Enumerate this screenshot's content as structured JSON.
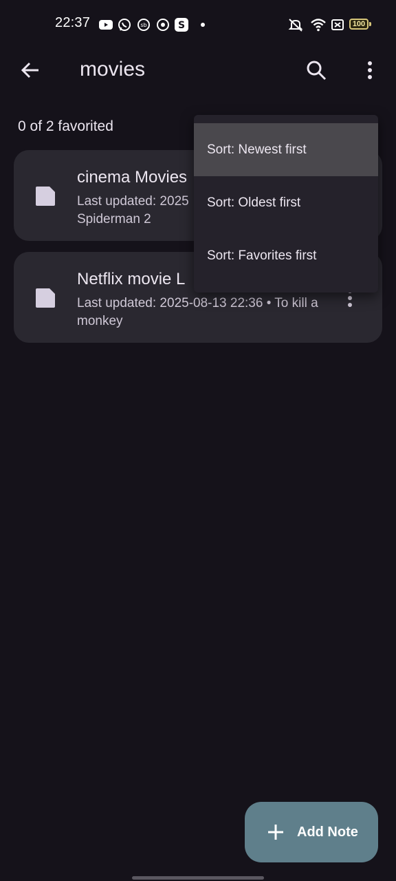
{
  "status_bar": {
    "time": "22:37",
    "notification_icons": [
      "youtube-icon",
      "whatsapp-icon",
      "sb-icon",
      "chrome-icon",
      "s-app-icon",
      "dot-icon"
    ],
    "system_icons": [
      "mute-icon",
      "wifi-icon",
      "sim-off-icon",
      "battery-icon"
    ],
    "battery_level": "100"
  },
  "app_bar": {
    "title": "movies",
    "back_icon": "arrow-back-icon",
    "search_icon": "search-icon",
    "more_icon": "more-vertical-icon"
  },
  "summary": {
    "favorited_text": "0 of 2 favorited"
  },
  "notes": [
    {
      "title": "cinema Movies",
      "subtitle": "Last updated: 2025",
      "subtitle_line2": "Spiderman 2"
    },
    {
      "title": "Netflix movie L",
      "subtitle": "Last updated: 2025-08-13 22:36 • To kill a monkey"
    }
  ],
  "sort_menu": {
    "items": [
      {
        "label": "Sort: Newest first",
        "highlighted": true
      },
      {
        "label": "Sort: Oldest first"
      },
      {
        "label": "Sort: Favorites first"
      }
    ]
  },
  "fab": {
    "label": "Add Note",
    "icon": "plus-icon"
  },
  "colors": {
    "background": "#15121a",
    "card": "#2a2830",
    "menu": "#25222b",
    "fab": "#5f7f8b"
  }
}
